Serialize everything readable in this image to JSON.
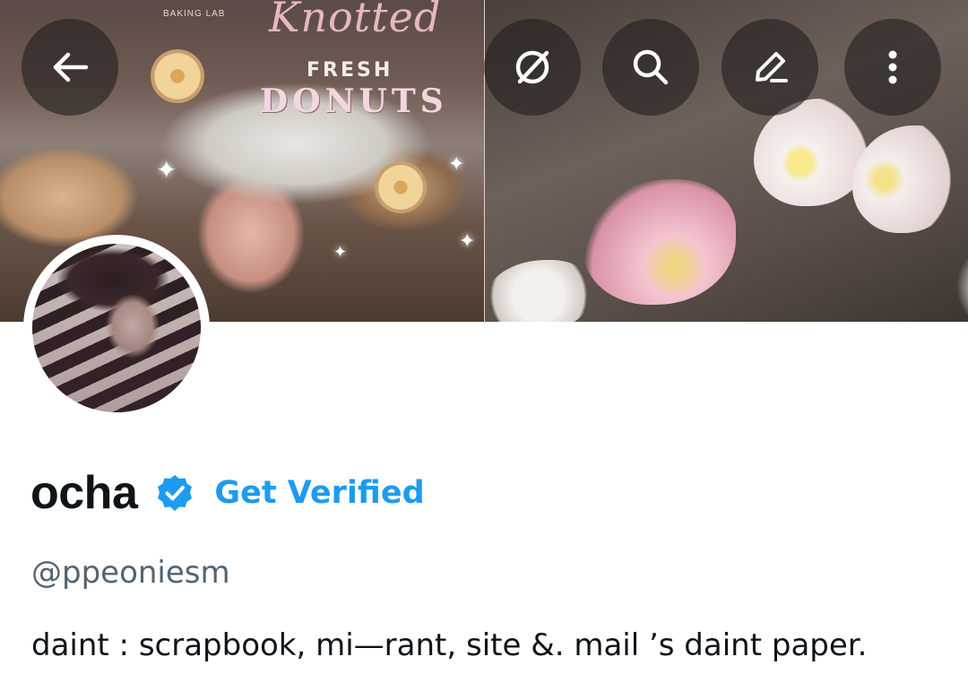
{
  "banner": {
    "sign_small": "BAKING LAB",
    "sign_script": "Knotted",
    "sign_fresh": "FRESH",
    "sign_donuts": "DONUTS"
  },
  "toolbar": {
    "back_icon": "arrow-left-icon",
    "grok_icon": "grok-icon",
    "search_icon": "search-icon",
    "edit_icon": "pencil-icon",
    "more_icon": "more-vertical-icon"
  },
  "profile": {
    "display_name": "ocha",
    "verified_badge_color": "#1d9bf0",
    "get_verified_label": "Get Verified",
    "handle": "@ppeoniesm",
    "bio": "daint : scrapbook, mi—rant, site &. mail ’s daint paper."
  },
  "colors": {
    "accent": "#1d9bf0",
    "text_primary": "#0f1419",
    "text_secondary": "#536471",
    "background": "#ffffff"
  }
}
